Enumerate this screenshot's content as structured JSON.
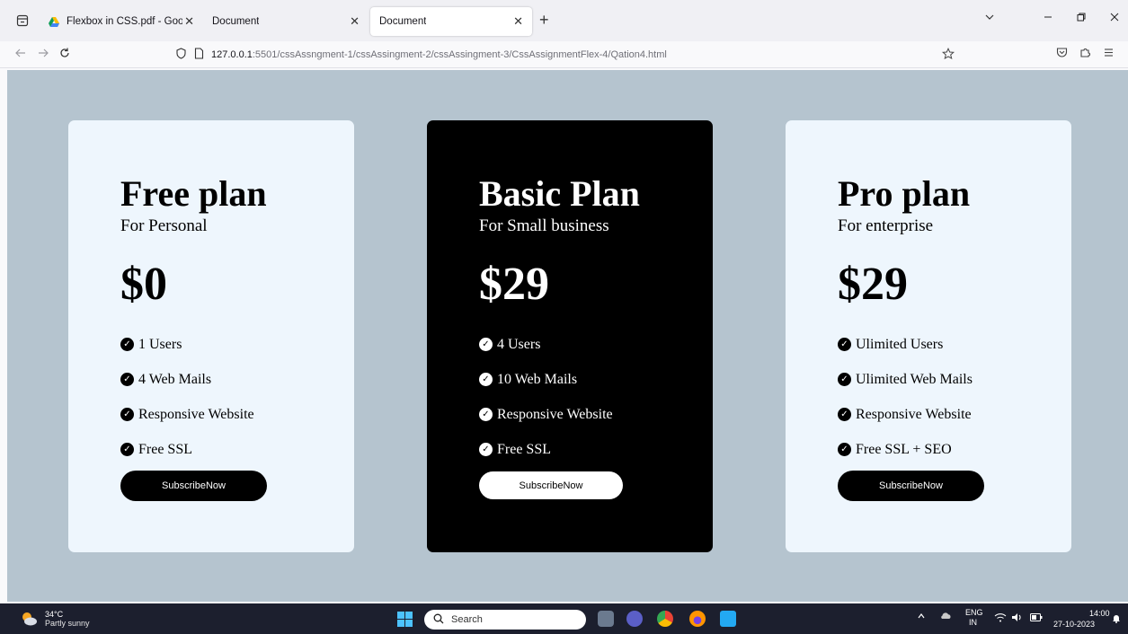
{
  "browser": {
    "tabs": [
      {
        "title": "Flexbox in CSS.pdf - Google Dri",
        "close": "✕"
      },
      {
        "title": "Document",
        "close": "✕"
      },
      {
        "title": "Document",
        "close": "✕"
      }
    ],
    "new_tab": "+",
    "url_host": "127.0.0.1",
    "url_path": ":5501/cssAssngment-1/cssAssingment-2/cssAssingment-3/CssAssignmentFlex-4/Qation4.html"
  },
  "plans": [
    {
      "name": "Free plan",
      "subtitle": "For Personal",
      "price": "$0",
      "features": [
        "1 Users",
        "4 Web Mails",
        "Responsive Website",
        "Free SSL"
      ],
      "button": "SubscribeNow"
    },
    {
      "name": "Basic Plan",
      "subtitle": "For Small business",
      "price": "$29",
      "features": [
        "4 Users",
        "10 Web Mails",
        "Responsive Website",
        "Free SSL"
      ],
      "button": "SubscribeNow"
    },
    {
      "name": "Pro plan",
      "subtitle": "For enterprise",
      "price": "$29",
      "features": [
        "Ulimited Users",
        "Ulimited Web Mails",
        "Responsive Website",
        "Free SSL + SEO"
      ],
      "button": "SubscribeNow"
    }
  ],
  "taskbar": {
    "temperature": "34°C",
    "condition": "Partly sunny",
    "search_placeholder": "Search",
    "lang_top": "ENG",
    "lang_bottom": "IN",
    "time": "14:00",
    "date": "27-10-2023"
  }
}
